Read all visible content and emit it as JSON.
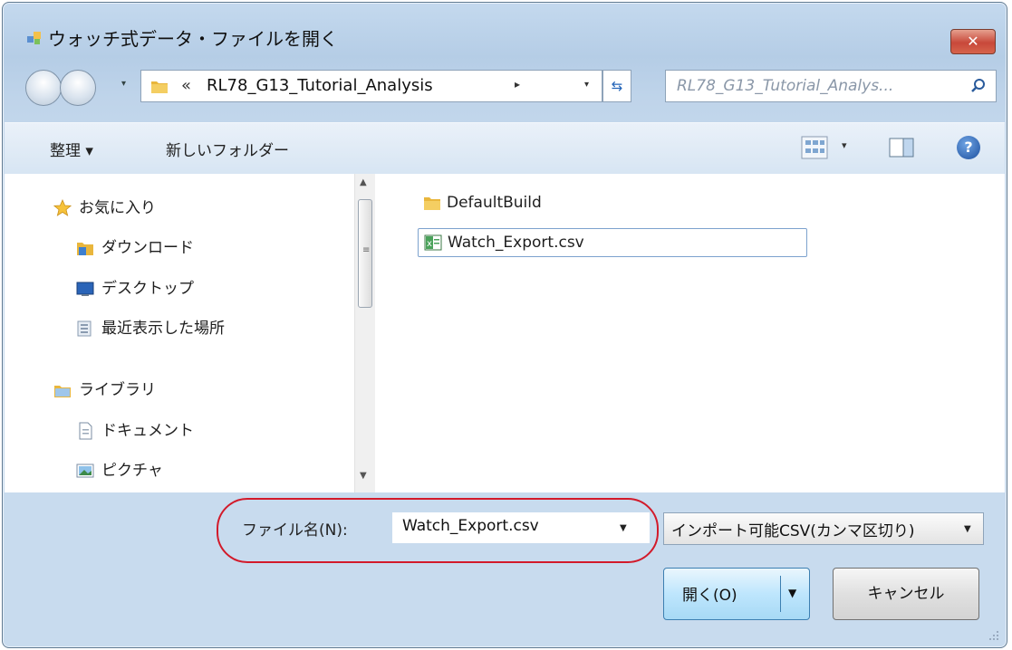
{
  "window": {
    "title": "ウォッチ式データ・ファイルを開く",
    "close_glyph": "✕"
  },
  "navbar": {
    "breadcrumb_chevron": "«",
    "path": "RL78_G13_Tutorial_Analysis",
    "path_arrow": "▸",
    "dropdown_glyph": "▾",
    "refresh_glyph": "⇆",
    "search_placeholder": "RL78_G13_Tutorial_Analys..."
  },
  "toolbar": {
    "organize_label": "整理 ▾",
    "new_folder_label": "新しいフォルダー",
    "view_dropdown_glyph": "▾",
    "help_glyph": "?"
  },
  "nav_pane": {
    "items": [
      {
        "label": "お気に入り",
        "icon": "star-icon"
      },
      {
        "label": "ダウンロード",
        "icon": "download-folder-icon"
      },
      {
        "label": "デスクトップ",
        "icon": "desktop-icon"
      },
      {
        "label": "最近表示した場所",
        "icon": "recent-places-icon"
      },
      {
        "label": "ライブラリ",
        "icon": "library-icon"
      },
      {
        "label": "ドキュメント",
        "icon": "document-icon"
      },
      {
        "label": "ピクチャ",
        "icon": "picture-icon"
      }
    ]
  },
  "scrollbar": {
    "up_glyph": "▲",
    "grip_glyph": "≡",
    "down_glyph": "▼"
  },
  "file_pane": {
    "items": [
      {
        "label": "DefaultBuild",
        "icon": "folder-icon",
        "selected": false
      },
      {
        "label": "Watch_Export.csv",
        "icon": "csv-file-icon",
        "selected": true
      }
    ]
  },
  "bottom": {
    "filename_label": "ファイル名(N):",
    "filename_value": "Watch_Export.csv",
    "dropdown_glyph": "▼",
    "filter_value": "インポート可能CSV(カンマ区切り)",
    "open_label": "開く(O)",
    "open_dropdown_glyph": "▼",
    "cancel_label": "キャンセル"
  },
  "colors": {
    "frame": "#c4d9ee",
    "toolbar": "#dfe9f5",
    "highlight_oval": "#d21a2a",
    "open_button": "#bee6fd",
    "close_button": "#c8483a"
  }
}
